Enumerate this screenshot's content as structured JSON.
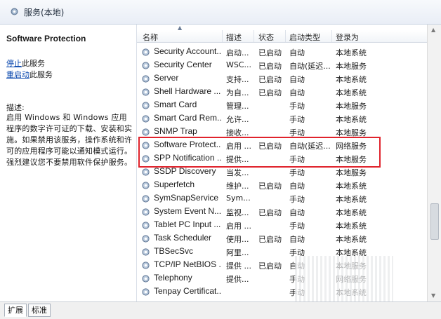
{
  "window": {
    "title": "服务(本地)"
  },
  "left_pane": {
    "service_title": "Software Protection",
    "stop_link": "停止",
    "stop_suffix": "此服务",
    "restart_link": "重启动",
    "restart_suffix": "此服务",
    "desc_label": "描述:",
    "description": "启用 Windows 和 Windows 应用程序的数字许可证的下载、安装和实施。如果禁用该服务，操作系统和许可的应用程序可能以通知模式运行。强烈建议您不要禁用软件保护服务。"
  },
  "columns": [
    "名称",
    "描述",
    "状态",
    "启动类型",
    "登录为"
  ],
  "services": [
    {
      "name": "Security Account...",
      "desc": "启动...",
      "status": "已启动",
      "startup": "自动",
      "logon": "本地系统"
    },
    {
      "name": "Security Center",
      "desc": "WSC...",
      "status": "已启动",
      "startup": "自动(延迟...",
      "logon": "本地服务"
    },
    {
      "name": "Server",
      "desc": "支持...",
      "status": "已启动",
      "startup": "自动",
      "logon": "本地系统"
    },
    {
      "name": "Shell Hardware ...",
      "desc": "为自...",
      "status": "已启动",
      "startup": "自动",
      "logon": "本地系统"
    },
    {
      "name": "Smart Card",
      "desc": "管理...",
      "status": "",
      "startup": "手动",
      "logon": "本地服务"
    },
    {
      "name": "Smart Card Rem...",
      "desc": "允许...",
      "status": "",
      "startup": "手动",
      "logon": "本地系统"
    },
    {
      "name": "SNMP Trap",
      "desc": "接收...",
      "status": "",
      "startup": "手动",
      "logon": "本地服务"
    },
    {
      "name": "Software Protect...",
      "desc": "启用 ...",
      "status": "已启动",
      "startup": "自动(延迟...",
      "logon": "网络服务"
    },
    {
      "name": "SPP Notification ...",
      "desc": "提供...",
      "status": "",
      "startup": "手动",
      "logon": "本地服务"
    },
    {
      "name": "SSDP Discovery",
      "desc": "当发...",
      "status": "",
      "startup": "手动",
      "logon": "本地服务"
    },
    {
      "name": "Superfetch",
      "desc": "维护...",
      "status": "已启动",
      "startup": "自动",
      "logon": "本地系统"
    },
    {
      "name": "SymSnapService",
      "desc": "Sym...",
      "status": "",
      "startup": "手动",
      "logon": "本地系统"
    },
    {
      "name": "System Event N...",
      "desc": "监视...",
      "status": "已启动",
      "startup": "自动",
      "logon": "本地系统"
    },
    {
      "name": "Tablet PC Input ...",
      "desc": "启用 ...",
      "status": "",
      "startup": "手动",
      "logon": "本地系统"
    },
    {
      "name": "Task Scheduler",
      "desc": "使用...",
      "status": "已启动",
      "startup": "自动",
      "logon": "本地系统"
    },
    {
      "name": "TBSecSvc",
      "desc": "阿里...",
      "status": "",
      "startup": "手动",
      "logon": "本地系统"
    },
    {
      "name": "TCP/IP NetBIOS ...",
      "desc": "提供 ...",
      "status": "已启动",
      "startup": "自动",
      "logon": "本地服务"
    },
    {
      "name": "Telephony",
      "desc": "提供...",
      "status": "",
      "startup": "手动",
      "logon": "网络服务"
    },
    {
      "name": "Tenpay Certificat...",
      "desc": "",
      "status": "",
      "startup": "手动",
      "logon": "本地系统"
    }
  ],
  "tabs": [
    "扩展",
    "标准"
  ],
  "colors": {
    "highlight_box": "#e0232c",
    "link": "#0645ad"
  }
}
